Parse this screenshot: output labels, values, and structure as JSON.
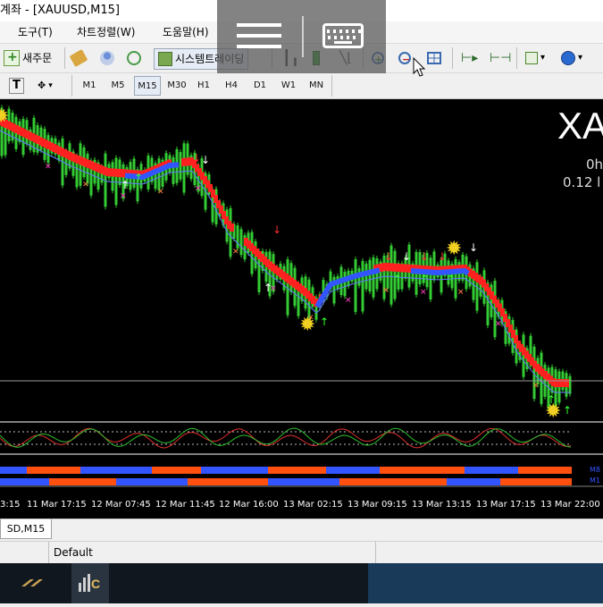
{
  "window": {
    "title": "계좌 - [XAUUSD,M15]"
  },
  "menu": {
    "items": [
      "도구(T)",
      "차트정렬(W)",
      "도움말(H)"
    ]
  },
  "toolbar": {
    "new_order": "새주문",
    "auto_trading": "시스템트레이딩"
  },
  "timeframes": {
    "items": [
      "M1",
      "M5",
      "M15",
      "M30",
      "H1",
      "H4",
      "D1",
      "W1",
      "MN"
    ],
    "active": "M15"
  },
  "chart": {
    "symbol_large": "XA",
    "info_line1": "0h",
    "info_line2": "0.12 l",
    "time_labels": [
      "3:15",
      "11 Mar 17:15",
      "12 Mar 07:45",
      "12 Mar 11:45",
      "12 Mar 16:00",
      "13 Mar 02:15",
      "13 Mar 09:15",
      "13 Mar 13:15",
      "13 Mar 17:15",
      "13 Mar 22:00"
    ],
    "right_labels": [
      "M8",
      "M1"
    ]
  },
  "tabs": {
    "active": "SD,M15"
  },
  "status": {
    "profile": "Default"
  },
  "colors": {
    "chart_bg": "#000000",
    "bull": "#33cc33",
    "bear": "#ff2020",
    "ma": "#3355ff"
  }
}
